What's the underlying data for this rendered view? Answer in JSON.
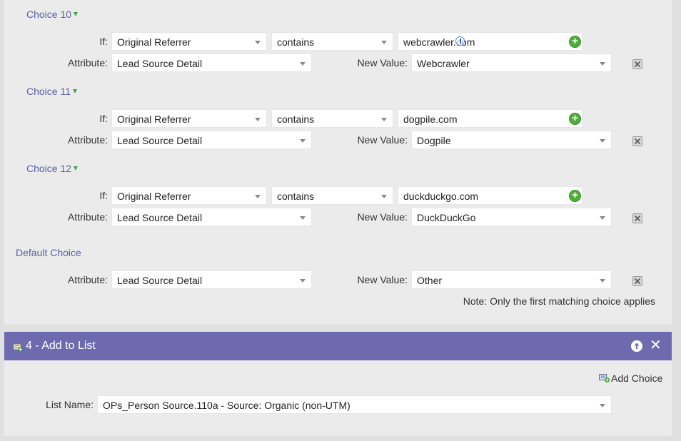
{
  "choices": [
    {
      "title": "Choice 10",
      "if_label": "If:",
      "field": "Original Referrer",
      "operator": "contains",
      "value": "webcrawler.com",
      "attr_label": "Attribute:",
      "attribute": "Lead Source Detail",
      "new_value_label": "New Value:",
      "new_value": "Webcrawler"
    },
    {
      "title": "Choice 11",
      "if_label": "If:",
      "field": "Original Referrer",
      "operator": "contains",
      "value": "dogpile.com",
      "attr_label": "Attribute:",
      "attribute": "Lead Source Detail",
      "new_value_label": "New Value:",
      "new_value": "Dogpile"
    },
    {
      "title": "Choice 12",
      "if_label": "If:",
      "field": "Original Referrer",
      "operator": "contains",
      "value": "duckduckgo.com",
      "attr_label": "Attribute:",
      "attribute": "Lead Source Detail",
      "new_value_label": "New Value:",
      "new_value": "DuckDuckGo"
    }
  ],
  "default_choice": {
    "title": "Default Choice",
    "attr_label": "Attribute:",
    "attribute": "Lead Source Detail",
    "new_value_label": "New Value:",
    "new_value": "Other"
  },
  "note": "Note: Only the first matching choice applies",
  "step": {
    "title": "4 - Add to List",
    "add_choice_label": "Add Choice",
    "list_name_label": "List Name:",
    "list_name": "OPs_Person Source.110a - Source: Organic (non-UTM)"
  },
  "icons": {
    "header": "add-to-list-icon",
    "up": "arrow-up-icon",
    "close": "close-icon",
    "add_choice": "add-choice-icon",
    "add_condition": "plus-circle-icon",
    "delete": "delete-icon"
  },
  "colors": {
    "header_bg": "#6e6ab0",
    "choice_title": "#5a5fa6",
    "plus_green": "#4fae3b"
  }
}
